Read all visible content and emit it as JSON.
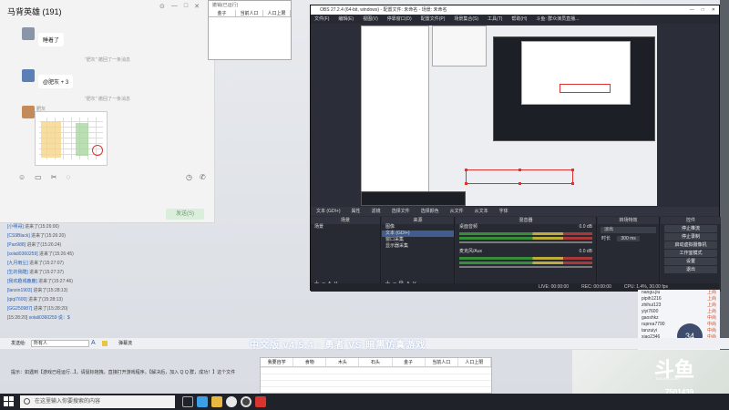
{
  "chat": {
    "title": "马背英雄 (191)",
    "window_buttons": [
      "⊙",
      "—",
      "□",
      "✕"
    ],
    "messages": [
      {
        "text": "睡着了"
      },
      {
        "text": "@肥灰 + 3"
      }
    ],
    "system_notices": [
      "\"肥灰\" 撤回了一条消息",
      "\"肥灰\" 撤回了一条消息"
    ],
    "sender_label": "肥灰",
    "send_button": "发送(S)"
  },
  "sheet_top": {
    "title": "撤销(已运行)",
    "headers": [
      "金子",
      "当前人口",
      "人口上限"
    ]
  },
  "obs": {
    "title": "OBS 27.2.4 (64-bit, windows) - 配置文件: 未命名 - 场景: 未命名",
    "menu": [
      "文件(F)",
      "编辑(E)",
      "视图(V)",
      "停靠窗口(D)",
      "配置文件(P)",
      "场景集合(S)",
      "工具(T)",
      "帮助(H)",
      "斗鱼: 群众演员直播..."
    ],
    "toolbar": [
      "文本 (GDI+)",
      "属性",
      "滤镜",
      "选择文件",
      "选择颜色",
      "从文件",
      "从文本",
      "字体"
    ],
    "panels": {
      "scenes": {
        "title": "场景",
        "items": [
          "场景"
        ]
      },
      "sources": {
        "title": "来源",
        "items": [
          "图像",
          "文本 (GDI+)",
          "窗口采集",
          "显示器采集"
        ]
      },
      "mixer": {
        "title": "混音器",
        "channels": [
          "桌面音频",
          "麦克风/Aux"
        ],
        "levels": [
          "0.0 dB",
          "0.0 dB"
        ]
      },
      "transitions": {
        "title": "转场特效",
        "type": "淡出",
        "duration_label": "时长",
        "duration": "300 ms"
      },
      "controls": {
        "title": "控件",
        "buttons": [
          "停止推流",
          "停止录制",
          "启动虚拟摄像机",
          "工作室模式",
          "设置",
          "退出"
        ]
      }
    },
    "status": [
      "LIVE: 00:00:00",
      "REC: 00:00:00",
      "CPU: 1.4%, 30.00 fps"
    ]
  },
  "viewers": [
    {
      "name": "nangu.jiu",
      "tag": "上尚"
    },
    {
      "name": "pipih1216",
      "tag": "上尚"
    },
    {
      "name": "zhihui123",
      "tag": "上尚"
    },
    {
      "name": "yiyi7600",
      "tag": "上尚"
    },
    {
      "name": "gaoshkz",
      "tag": "中尚"
    },
    {
      "name": "ruprea7790",
      "tag": "中尚"
    },
    {
      "name": "tanzuiyi",
      "tag": "中尚"
    },
    {
      "name": "xiao2346",
      "tag": "中尚"
    },
    {
      "name": "roolong1",
      "tag": "上尚"
    }
  ],
  "streamer_badge": "34",
  "log": [
    {
      "user": "[小明哥]",
      "text": "进来了(15:26:00)"
    },
    {
      "user": "[CS9Black]",
      "text": "进来了(15:26:20)"
    },
    {
      "user": "[Pan988]",
      "text": "进来了(15:26:24)"
    },
    {
      "user": "[solali0360259]",
      "text": "进来了(15:26:45)"
    },
    {
      "user": "[九月雨尘]",
      "text": "进来了(15:27:07)"
    },
    {
      "user": "[生的我酷]",
      "text": "进来了(15:27:37)"
    },
    {
      "user": "[我欢趣城鹿鹿]",
      "text": "进来了(15:27:46)"
    },
    {
      "user": "[lanxin1903]",
      "text": "进来了(15:28:13)"
    },
    {
      "user": "[qiqi7600]",
      "text": "进来了(15:28:13)"
    },
    {
      "user": "[GG250987]",
      "text": "进来了(15:28:20)"
    },
    {
      "user": "[15:28:20]",
      "text": "solali0360259 说：$"
    }
  ],
  "input": {
    "send_to_label": "发送给:",
    "placeholder": "所有人",
    "danmu_label": "弹幕流"
  },
  "overlay_text": "中文版 v4.5.4 · 勇者 VS 暗黑仿真游戏",
  "tip": "提示：如遇到【游戏已经运行...】，请鼠标拖拽，直接打开游戏程序。【解决后，加入 Q Q 群，成功！】这个文件",
  "bottom_table": {
    "headers": [
      "我要自学",
      "食物",
      "木头",
      "石头",
      "金子",
      "当前人口",
      "人口上限"
    ]
  },
  "logo": {
    "mark": "斗鱼",
    "sub": "DOUYU.COM",
    "room_id": "7501439"
  },
  "taskbar": {
    "search_placeholder": "在这里输入你要搜索的内容"
  }
}
